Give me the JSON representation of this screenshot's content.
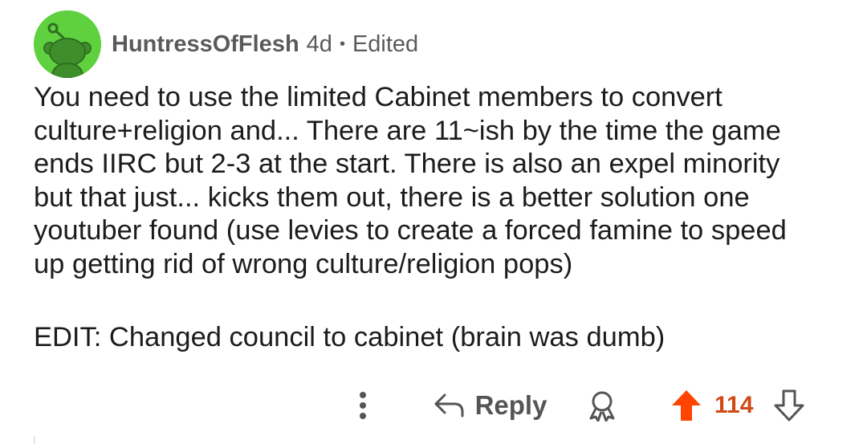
{
  "comment": {
    "author": "HuntressOfFlesh",
    "age": "4d",
    "separator": "•",
    "edited_label": "Edited",
    "body": "You need to use the limited Cabinet members to convert\nculture+religion and... There are 11~ish by the time the game\nends IIRC but 2-3 at the start. There is also an expel minority\nbut that just... kicks them out, there is a better solution one\nyoutuber found (use levies to create a forced famine to speed\nup getting rid of wrong culture/religion pops)",
    "edit_note": "EDIT: Changed council to cabinet (brain was dumb)"
  },
  "actions": {
    "reply_label": "Reply",
    "score": "114",
    "icons": {
      "more": "more-vertical-icon",
      "reply": "reply-arrow-icon",
      "award": "award-icon",
      "upvote": "upvote-arrow-icon",
      "downvote": "downvote-arrow-icon"
    }
  },
  "colors": {
    "avatar_bg": "#5fd13f",
    "upvote_active": "#ff4500",
    "score": "#d04a16",
    "text": "#1c1c1c",
    "meta": "#5a5a5a"
  }
}
